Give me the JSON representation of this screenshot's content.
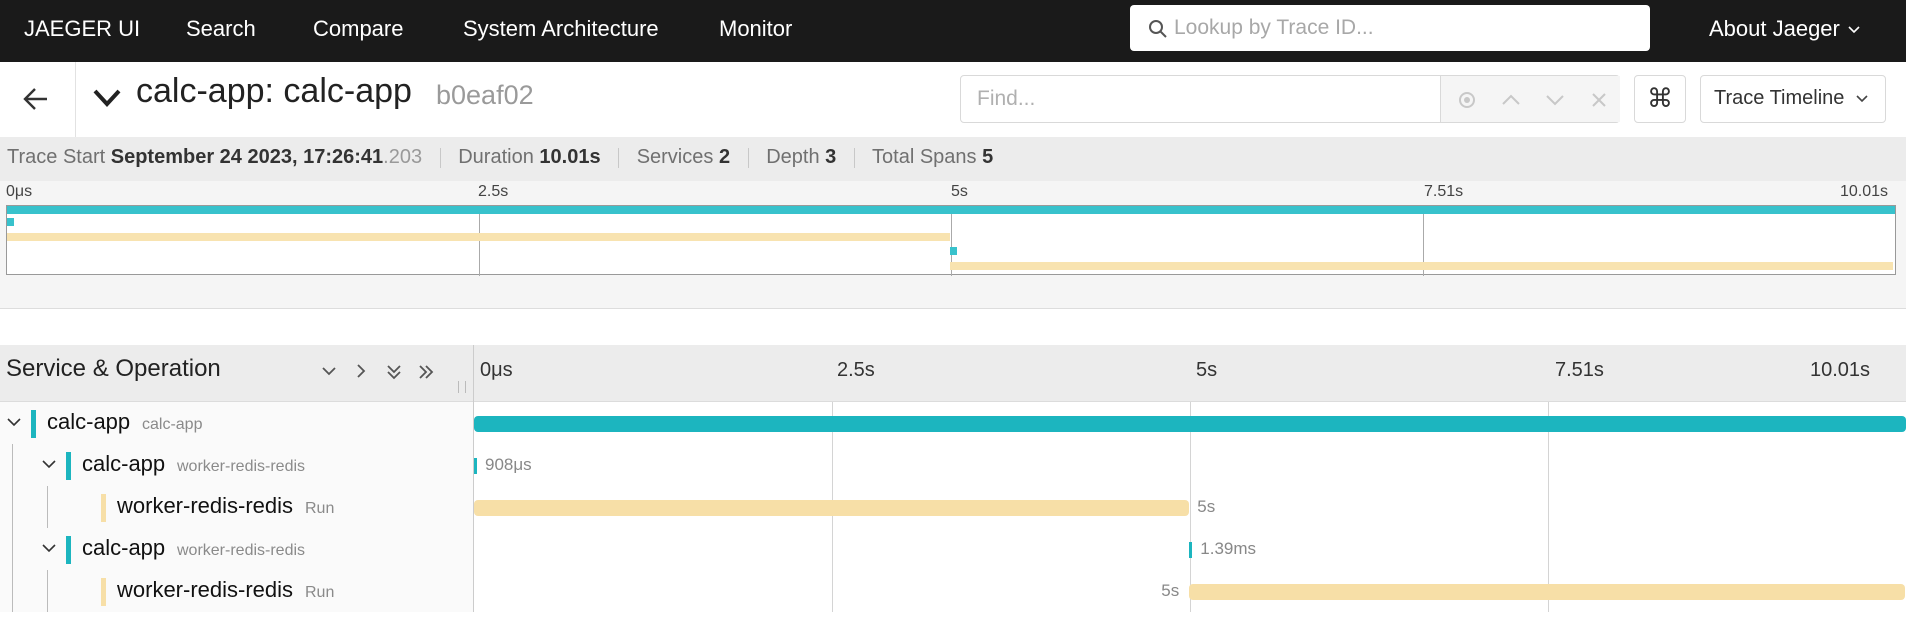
{
  "nav": {
    "brand": "JAEGER UI",
    "items": [
      "Search",
      "Compare",
      "System Architecture",
      "Monitor"
    ],
    "search_placeholder": "Lookup by Trace ID...",
    "about": "About Jaeger"
  },
  "header": {
    "title": "calc-app: calc-app",
    "trace_id": "b0eaf02",
    "find_placeholder": "Find...",
    "kbd_icon": "⌘",
    "view_mode": "Trace Timeline"
  },
  "summary": {
    "trace_start_label": "Trace Start",
    "trace_start_value": "September 24 2023, 17:26:41",
    "trace_start_ms": ".203",
    "duration_label": "Duration",
    "duration_value": "10.01s",
    "services_label": "Services",
    "services_value": "2",
    "depth_label": "Depth",
    "depth_value": "3",
    "total_spans_label": "Total Spans",
    "total_spans_value": "5"
  },
  "minimap": {
    "ticks": [
      "0μs",
      "2.5s",
      "5s",
      "7.51s",
      "10.01s"
    ]
  },
  "timeline": {
    "column_title": "Service & Operation",
    "ticks": [
      "0μs",
      "2.5s",
      "5s",
      "7.51s",
      "10.01s"
    ],
    "total_seconds": 10.01
  },
  "colors": {
    "calc_app": "#1cb5bf",
    "worker_redis": "#f7dfa7",
    "minimap_teal": "#38c2cc",
    "minimap_yellow": "#f8e3b0"
  },
  "spans": [
    {
      "service": "calc-app",
      "operation": "calc-app",
      "start_s": 0,
      "duration_s": 10.01,
      "label": "",
      "color": "calc_app",
      "depth": 0,
      "collapsible": true
    },
    {
      "service": "calc-app",
      "operation": "worker-redis-redis",
      "start_s": 0,
      "duration_s": 0.000908,
      "label": "908μs",
      "color": "calc_app",
      "depth": 1,
      "collapsible": true
    },
    {
      "service": "worker-redis-redis",
      "operation": "Run",
      "start_s": 0,
      "duration_s": 5.0,
      "label": "5s",
      "color": "worker_redis",
      "depth": 2,
      "collapsible": false
    },
    {
      "service": "calc-app",
      "operation": "worker-redis-redis",
      "start_s": 5.0,
      "duration_s": 0.00139,
      "label": "1.39ms",
      "color": "calc_app",
      "depth": 1,
      "collapsible": true
    },
    {
      "service": "worker-redis-redis",
      "operation": "Run",
      "start_s": 5.0,
      "duration_s": 5.0,
      "label": "5s",
      "color": "worker_redis",
      "depth": 2,
      "collapsible": false
    }
  ]
}
